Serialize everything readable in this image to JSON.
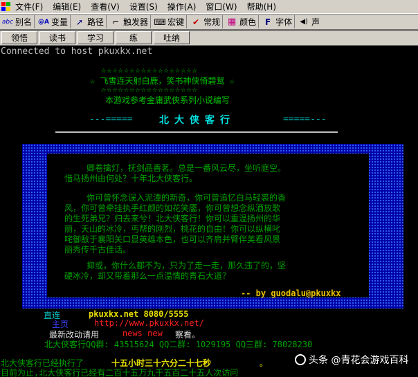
{
  "menu": {
    "items": [
      {
        "label": "文件(F)",
        "name": "menu-file"
      },
      {
        "label": "编辑(E)",
        "name": "menu-edit"
      },
      {
        "label": "查看(V)",
        "name": "menu-view"
      },
      {
        "label": "设置(S)",
        "name": "menu-settings"
      },
      {
        "label": "操作(A)",
        "name": "menu-action"
      },
      {
        "label": "窗口(W)",
        "name": "menu-window"
      },
      {
        "label": "帮助(H)",
        "name": "menu-help"
      }
    ]
  },
  "toolbar": {
    "items": [
      {
        "label": "别名",
        "icon": "abc-icon",
        "glyph": "abc",
        "color": "#0000c0"
      },
      {
        "label": "变量",
        "icon": "variable-icon",
        "glyph": "@A",
        "color": "#0000c0"
      },
      {
        "label": "路径",
        "icon": "path-icon",
        "glyph": "➚",
        "color": "#000080"
      },
      {
        "label": "触发器",
        "icon": "trigger-icon",
        "glyph": "⌐",
        "color": "#000000"
      },
      {
        "label": "宏键",
        "icon": "macro-key-icon",
        "glyph": "⌨",
        "color": "#000000"
      },
      {
        "label": "常规",
        "icon": "check-icon",
        "glyph": "✔",
        "color": "#c00000"
      },
      {
        "label": "颜色",
        "icon": "color-icon",
        "glyph": "▦",
        "color": "#c00080"
      },
      {
        "label": "字体",
        "icon": "font-icon",
        "glyph": "F",
        "color": "#000080"
      },
      {
        "label": "声",
        "icon": "sound-icon",
        "glyph": "◀)",
        "color": "#000000"
      }
    ]
  },
  "commands": {
    "buttons": [
      "领悟",
      "读书",
      "学习",
      "练",
      "吐纳"
    ]
  },
  "terminal": {
    "connected": "Connected to host pkuxkx.net",
    "stars": "☆☆☆☆☆☆☆☆☆☆☆☆☆☆☆☆☆",
    "subtitle": "☆ 飞雪连天射白鹿，笑书神侠倚碧鸳 ☆",
    "note": "本游戏参考金庸武侠系列小说编写",
    "title_dash_left": "---=====",
    "title": "北大侠客行",
    "title_dash_right": "=====---",
    "para1": [
      "卿卷擒灯，抚剑品香茗。总是一番风云尽，坐听庭空。",
      "惜马扬州由何处？十年北大侠客行。"
    ],
    "para2": [
      "你可曾怀念误入泥潭的新奇，你可曾追忆白马轻裘的香",
      "风，你可曾牵挂执手红颜的如花笑靥，你可曾想念纵酒放歌",
      "的生死弟兄？归去来兮！北大侠客行！你可以重温扬州的华",
      "丽，天山的冰冷，丐帮的刚烈，桃花的自由！你可以纵横叱",
      "咤御敌于襄阳关口显英雄本色，也可以齐肩并臂伴美看风景",
      "丽秀传千古佳话。"
    ],
    "para3": [
      "抑或，你什么都不为，只为了走一走，那久违了的，坚",
      "硬冰冷，却又带着那么一点温情的青石大道？"
    ],
    "signature": "-- by guodalu@pkuxkx",
    "direct_label": "直连",
    "direct_host": "pkuxkx.net 8080/5555",
    "home_label": "主页",
    "home_url": "http://www.pkuxkx.net/",
    "news_prefix": "最新改动请用",
    "news_cmd": "news new",
    "news_suffix": "察看。",
    "qq": "北大侠客行QQ群: 43515624  QQ二群: 1029195  QQ三群: 78028230",
    "exec_prefix": "北大侠客行已经执行了",
    "exec_time": "十五小时三十六分二十七秒",
    "exec_suffix": "。",
    "visits": "目前为止,北大侠客行已经有二百十五万九千五百二十五人次访问"
  },
  "watermark": "头条 @青花会游戏百科"
}
